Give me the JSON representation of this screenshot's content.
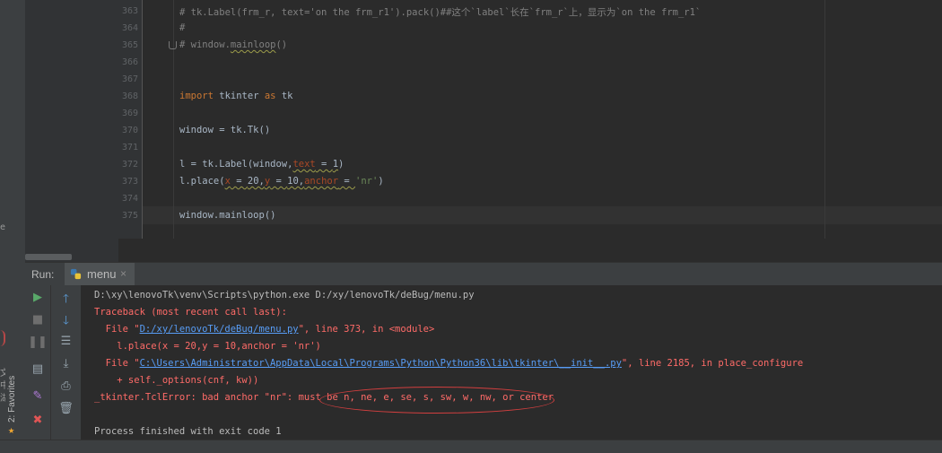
{
  "left_strip": {
    "favorites_label": "2: Favorites",
    "fragment_a": "el",
    "fragment_b": "文 中 湖",
    "scroll_arrow": "<",
    "star_icon": "star-icon"
  },
  "editor": {
    "lines": [
      {
        "num": "363",
        "text": "# tk.Label(frm_r, text='on the frm_r1').pack()##这个`label`长在`frm_r`上，显示为`on the frm_r1`"
      },
      {
        "num": "364",
        "text": "#"
      },
      {
        "num": "365",
        "text_prefix": "# window.",
        "text_squig": "mainloop",
        "text_suffix": "()"
      },
      {
        "num": "366",
        "text": ""
      },
      {
        "num": "367",
        "text": ""
      },
      {
        "num": "368",
        "kw": "import",
        "mid": " tkinter ",
        "kw2": "as",
        "tail": " tk"
      },
      {
        "num": "369",
        "text": ""
      },
      {
        "num": "370",
        "text": "window = tk.Tk()"
      },
      {
        "num": "371",
        "text": ""
      },
      {
        "num": "372",
        "pre": "l = tk.Label(window,",
        "param": "text",
        "eq": " = ",
        "val": "1",
        "post": ")"
      },
      {
        "num": "373",
        "pre": "l.place(",
        "p1": "x",
        "e1": " = ",
        "v1": "20,",
        "p2": "y",
        "e2": " = ",
        "v2": "10,",
        "p3": "anchor",
        "e3": " = ",
        "v3": "'nr'",
        "post": ")"
      },
      {
        "num": "374",
        "text": ""
      },
      {
        "num": "375",
        "text": "window.mainloop()"
      }
    ]
  },
  "run_panel": {
    "label": "Run:",
    "tab_label": "menu",
    "tab_close": "×"
  },
  "toolbar_icons": {
    "col1": [
      "run-icon",
      "stop-icon",
      "pause-icon",
      "dump-threads-icon",
      "pin-icon",
      "close-icon"
    ],
    "col2": [
      "up-arrow-icon",
      "down-arrow-icon",
      "soft-wrap-icon",
      "scroll-to-end-icon",
      "print-icon",
      "trash-icon"
    ]
  },
  "console": {
    "line1": "D:\\xy\\lenovoTk\\venv\\Scripts\\python.exe D:/xy/lenovoTk/deBug/menu.py",
    "line2": "Traceback (most recent call last):",
    "line3_a": "  File \"",
    "line3_link": "D:/xy/lenovoTk/deBug/menu.py",
    "line3_b": "\", line 373, in <module>",
    "line4": "    l.place(x = 20,y = 10,anchor = 'nr')",
    "line5_a": "  File \"",
    "line5_link": "C:\\Users\\Administrator\\AppData\\Local\\Programs\\Python\\Python36\\lib\\tkinter\\__init__.py",
    "line5_b": "\", line 2185, in place_configure",
    "line6": "    + self._options(cnf, kw))",
    "line7": "_tkinter.TclError: bad anchor \"nr\": must be n, ne, e, se, s, sw, w, nw, or center",
    "line8": "",
    "line9": "Process finished with exit code 1"
  },
  "colors": {
    "bg": "#2b2b2b",
    "panel": "#3c3f41",
    "keyword": "#cc7832",
    "comment": "#808080",
    "error": "#ff6b68",
    "link": "#589df6",
    "annotation": "#d23f3f"
  }
}
